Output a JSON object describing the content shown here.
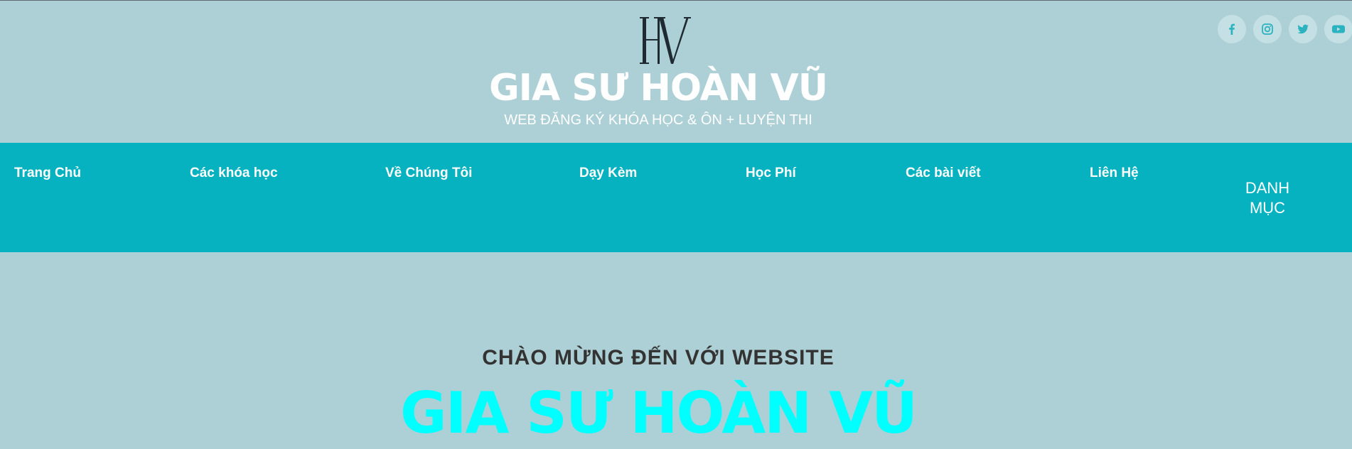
{
  "header": {
    "logo": {
      "letters": "HV",
      "icon": "hv-monogram-logo"
    },
    "title": "GIA SƯ HOÀN VŨ",
    "tagline": "WEB ĐĂNG KÝ KHÓA HỌC & ÔN + LUYỆN THI",
    "social": [
      {
        "name": "facebook",
        "icon": "facebook-icon",
        "glyph": "f"
      },
      {
        "name": "instagram",
        "icon": "instagram-icon"
      },
      {
        "name": "twitter",
        "icon": "twitter-icon"
      },
      {
        "name": "youtube",
        "icon": "youtube-icon"
      }
    ]
  },
  "nav": {
    "items": [
      {
        "label": "Trang Chủ"
      },
      {
        "label": "Các khóa học"
      },
      {
        "label": "Về Chúng Tôi"
      },
      {
        "label": "Dạy Kèm"
      },
      {
        "label": "Học Phí"
      },
      {
        "label": "Các bài viết"
      },
      {
        "label": "Liên Hệ"
      }
    ],
    "menu_line1": "DANH",
    "menu_line2": "MỤC"
  },
  "hero": {
    "subtitle": "CHÀO MỪNG ĐẾN VỚI WEBSITE",
    "title": "GIA SƯ HOÀN VŨ"
  },
  "colors": {
    "page_background": "#add0d6",
    "nav_background": "#06b2c0",
    "hero_title": "#00ffff",
    "social_icon": "#2bb3bf",
    "social_circle": "#c5e0e5"
  }
}
